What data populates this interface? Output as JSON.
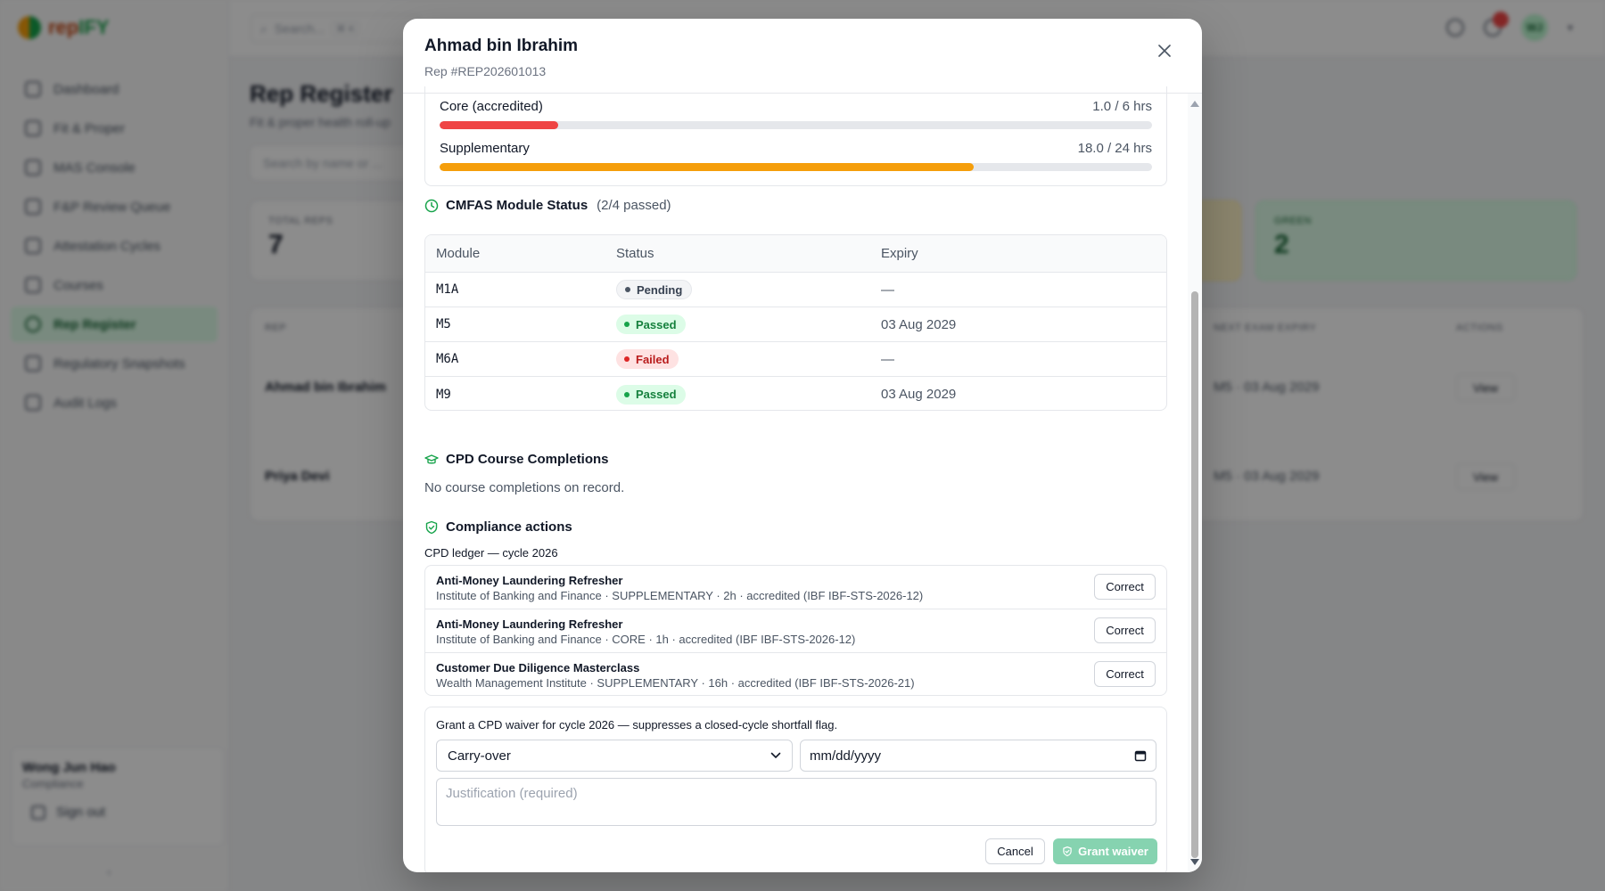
{
  "background": {
    "brand": {
      "name": "rep",
      "accent": "IFY"
    },
    "nav": [
      "Dashboard",
      "Fit & Proper",
      "MAS Console",
      "F&P Review Queue",
      "Attestation Cycles",
      "Courses",
      "Rep Register",
      "Regulatory Snapshots",
      "Audit Logs"
    ],
    "active_nav": "Rep Register",
    "search_placeholder": "Search...",
    "search_kbd": "⌘ K",
    "avatar_initials": "WJ",
    "user": {
      "name": "Wong Jun Hao",
      "role": "Compliance",
      "signout": "Sign out"
    },
    "page_title": "Rep Register",
    "page_subtitle": "Fit & proper health roll-up",
    "page_search_placeholder": "Search by name or ...",
    "stats": [
      {
        "label": "Total reps",
        "value": "7"
      },
      {
        "label": "",
        "value": ""
      },
      {
        "label": "Green",
        "value": "2"
      }
    ],
    "table_headers": [
      "Rep",
      "Next exam expiry",
      "Actions"
    ],
    "rows": [
      {
        "name": "Ahmad bin Ibrahim",
        "expiry": "M5 · 03 Aug 2029",
        "action": "View"
      },
      {
        "name": "Priya Devi",
        "expiry": "M5 · 03 Aug 2029",
        "action": "View"
      }
    ]
  },
  "modal": {
    "title": "Ahmad bin Ibrahim",
    "subtitle": "Rep #REP202601013",
    "close_label": "×",
    "cpd_progress": [
      {
        "label": "Core (accredited)",
        "value_text": "1.0 / 6 hrs",
        "completed": 1.0,
        "required": 6,
        "color": "#ef4444"
      },
      {
        "label": "Supplementary",
        "value_text": "18.0 / 24 hrs",
        "completed": 18.0,
        "required": 24,
        "color": "#f59e0b"
      }
    ],
    "cmfas": {
      "title": "CMFAS Module Status",
      "count": "(2/4 passed)",
      "headers": {
        "module": "Module",
        "status": "Status",
        "expiry": "Expiry"
      },
      "rows": [
        {
          "module": "M1A",
          "status": "Pending",
          "status_kind": "pending",
          "expiry": "—"
        },
        {
          "module": "M5",
          "status": "Passed",
          "status_kind": "passed",
          "expiry": "03 Aug 2029"
        },
        {
          "module": "M6A",
          "status": "Failed",
          "status_kind": "failed",
          "expiry": "—"
        },
        {
          "module": "M9",
          "status": "Passed",
          "status_kind": "passed",
          "expiry": "03 Aug 2029"
        }
      ]
    },
    "cpd_courses": {
      "title": "CPD Course Completions",
      "empty": "No course completions on record."
    },
    "compliance": {
      "title": "Compliance actions",
      "ledger_title": "CPD ledger — cycle 2026",
      "correct_label": "Correct",
      "entries": [
        {
          "name": "Anti-Money Laundering Refresher",
          "meta": "Institute of Banking and Finance · SUPPLEMENTARY · 2h · accredited (IBF IBF-STS-2026-12)"
        },
        {
          "name": "Anti-Money Laundering Refresher",
          "meta": "Institute of Banking and Finance · CORE · 1h · accredited (IBF IBF-STS-2026-12)"
        },
        {
          "name": "Customer Due Diligence Masterclass",
          "meta": "Wealth Management Institute · SUPPLEMENTARY · 16h · accredited (IBF IBF-STS-2026-21)"
        }
      ],
      "waiver": {
        "description": "Grant a CPD waiver for cycle 2026 — suppresses a closed-cycle shortfall flag.",
        "type_selected": "Carry-over",
        "date_placeholder": "mm/dd/yyyy",
        "justification_placeholder": "Justification (required)",
        "cancel_label": "Cancel",
        "grant_label": "Grant waiver"
      }
    }
  },
  "colors": {
    "accent": "#16a34a",
    "grant_disabled": "#86d3b0",
    "core_bar": "#ef4444",
    "supp_bar": "#f59e0b"
  }
}
